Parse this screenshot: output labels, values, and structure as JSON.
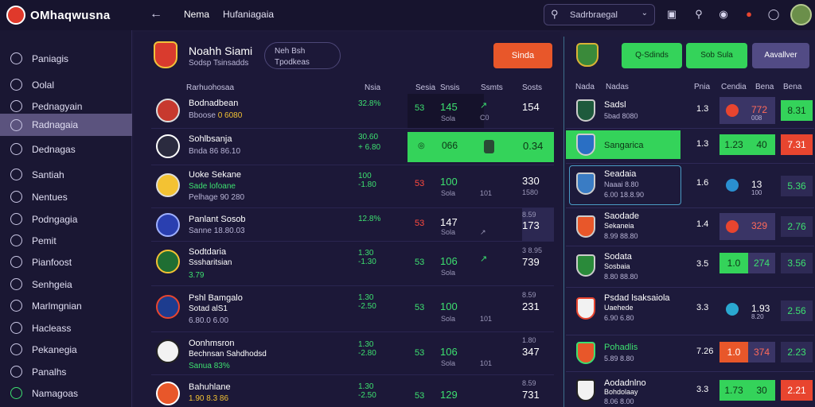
{
  "app": {
    "title": "OMhaqwusna"
  },
  "topbar": {
    "back_icon": "arrow-left-icon",
    "nav": [
      "Nema",
      "Hufaniagaia"
    ],
    "search_placeholder": "Sadrbraegal"
  },
  "sidebar": {
    "items": [
      "Paniagis",
      "Oolal",
      "Pednagyain",
      "Radnagaia",
      "Dednagas",
      "Santiah",
      "Nentues",
      "Podngagia",
      "Pemit",
      "Pianfoost",
      "Senhgeia",
      "Marlmgnian",
      "Hacleass",
      "Pekanegia",
      "Panalhs",
      "Namagoas"
    ],
    "active_index": 3
  },
  "main": {
    "team_title": "Noahh Siami",
    "team_sub": "Sodsp Tsinsadds",
    "pill_line1": "Neh Bsh",
    "pill_line2": "Tpodkeas",
    "action_button": "Sinda",
    "columns": [
      "Rarhuohosaa",
      "Nsia",
      "Sesia",
      "Snsis",
      "Ssmts",
      "Sosts"
    ],
    "rows": [
      {
        "name": "Bodnadbean",
        "sub_a": "Bboose ",
        "sub_b": "0 6080",
        "pct": "32.8%",
        "pct2": "",
        "c1": "53",
        "c2": "145",
        "c2s": "Sola",
        "c3": "↗",
        "c3s": "C0",
        "c4": "154",
        "c4s": ""
      },
      {
        "name": "Sohlbsanja",
        "sub_a": "Bnda 86 86.10",
        "sub_b": "",
        "pct": "30.60",
        "pct2": "+ 6.80",
        "c1": "◎",
        "c2": "066",
        "c2s": "Sola",
        "c3": "",
        "c3s": "",
        "c4": "0.34",
        "c4s": ""
      },
      {
        "name": "Uoke Sekane",
        "sub_a": "Sade lofoane",
        "sub_b": "Pelhage 90 280",
        "pct": "100",
        "pct2": "-1.80",
        "c1": "53",
        "c2": "100",
        "c2s": "Sola",
        "c3": "",
        "c3s": "101",
        "c4": "330",
        "c4s": "1580"
      },
      {
        "name": "Panlant Sosob",
        "sub_a": "Sanne 18.80.03",
        "sub_b": "",
        "pct": "12.8%",
        "pct2": "",
        "c1": "53",
        "c2": "147",
        "c2s": "Sola",
        "c3": "",
        "c3s": "↗",
        "c4": "173",
        "c4s": "8.59"
      },
      {
        "name": "Sodtdaria",
        "sub_a": "Sssharitsian",
        "sub_b": "3.79",
        "pct": "1.30",
        "pct2": "-1.30",
        "c1": "53",
        "c2": "106",
        "c2s": "Sola",
        "c3": "↗",
        "c3s": "",
        "c4": "739",
        "c4s": "3 8.95"
      },
      {
        "name": "Pshl Bamgalo",
        "sub_a": "Sotad alS1",
        "sub_b": "6.80.0 6.00",
        "pct": "1.30",
        "pct2": "-2.50",
        "c1": "53",
        "c2": "100",
        "c2s": "Sola",
        "c3": "",
        "c3s": "101",
        "c4": "231",
        "c4s": "8.59"
      },
      {
        "name": "Oonhmsron",
        "sub_a": "Bechnsan Sahdhodsd",
        "sub_b": "Sanua 83%",
        "pct": "1.30",
        "pct2": "-2.80",
        "c1": "53",
        "c2": "106",
        "c2s": "Sola",
        "c3": "",
        "c3s": "101",
        "c4": "347",
        "c4s": "1.80"
      },
      {
        "name": "Bahuhlane",
        "sub_a": "1.90 8.3 86",
        "sub_b": "",
        "pct": "1.30",
        "pct2": "-2.50",
        "c1": "53",
        "c2": "129",
        "c2s": "Sola",
        "c3": "",
        "c3s": "",
        "c4": "731",
        "c4s": "8.59"
      }
    ]
  },
  "right": {
    "buttons": [
      "Q-Sdinds",
      "Sob Sula",
      "Aavallver"
    ],
    "columns": [
      "Nada",
      "Nadas",
      "Pnia",
      "Cendia",
      "Bena",
      "Bena"
    ],
    "rows": [
      {
        "name": "Sadsl",
        "sub": "5bad 8080",
        "n": "1.3",
        "o2": "772",
        "o3": "008",
        "odd": "8.31",
        "odd_style": "green"
      },
      {
        "name": "Sangarica",
        "sub": "",
        "n": "1.3",
        "o2": "1.23",
        "o3": "",
        "split_mid": "40",
        "odd": "7.31",
        "odd_style": "red"
      },
      {
        "name": "Seadaia",
        "sub": "Naaai 8.80",
        "sub2": "6.00 18.8.90",
        "n": "1.6",
        "o2": "13",
        "o3": "100",
        "odd": "5.36",
        "odd_style": "dark"
      },
      {
        "name": "Saodade",
        "sub": "Sekaneia",
        "sub2": "8.99 88.80",
        "n": "1.4",
        "o2": "329",
        "o3": "",
        "odd": "2.76",
        "odd_style": "dark"
      },
      {
        "name": "Sodata",
        "sub": "Sosbaia",
        "sub2": "8.80 88.80",
        "n": "3.5",
        "o2": "274",
        "o3": "",
        "split_left": "1.0",
        "odd": "3.56",
        "odd_style": "dark"
      },
      {
        "name": "Psdad lsaksaiola",
        "sub": "Uaehede",
        "sub2": "6.90 6.80",
        "n": "3.3",
        "o2": "1.93",
        "o3": "8.20",
        "odd": "2.56",
        "odd_style": "dark"
      },
      {
        "name": "Pohadlis",
        "sub": "5.89 8.80",
        "n": "7.26",
        "o2": "374",
        "o3": "",
        "split_left": "1.0",
        "odd": "2.23",
        "odd_style": "dark"
      },
      {
        "name": "Aodadnlno",
        "sub": "Bohdolaay",
        "sub2": "8.06 8.00",
        "n": "3.3",
        "o2": "30",
        "o3": "",
        "split_left": "1.73",
        "odd": "2.21",
        "odd_style": "red"
      }
    ]
  },
  "colors": {
    "green": "#34d35a",
    "orange": "#e8572a",
    "red": "#e8452f",
    "purple": "#524b85"
  }
}
